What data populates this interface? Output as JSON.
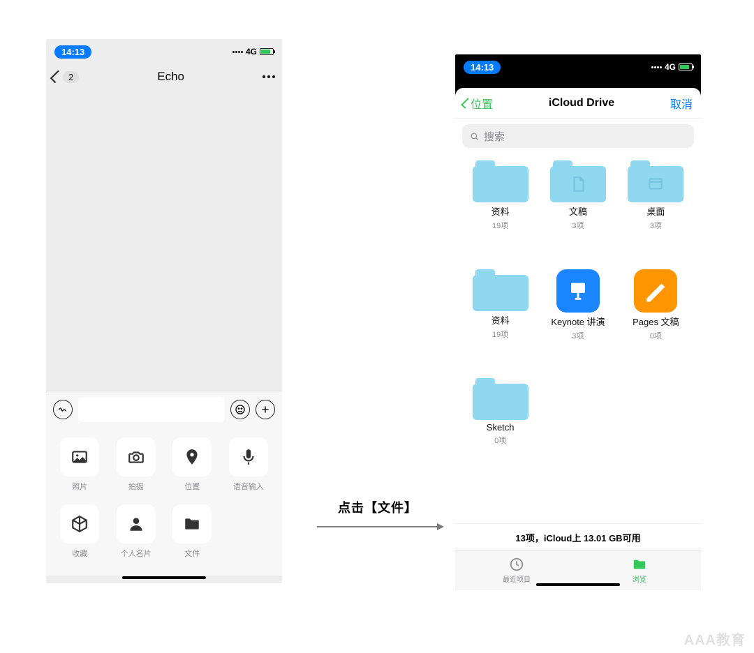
{
  "left": {
    "status": {
      "time": "14:13",
      "network": "4G"
    },
    "nav": {
      "unread": "2",
      "title": "Echo"
    },
    "attach": [
      {
        "id": "photo",
        "label": "照片"
      },
      {
        "id": "camera",
        "label": "拍摄"
      },
      {
        "id": "location",
        "label": "位置"
      },
      {
        "id": "voice",
        "label": "语音输入"
      },
      {
        "id": "fav",
        "label": "收藏"
      },
      {
        "id": "card",
        "label": "个人名片"
      },
      {
        "id": "file",
        "label": "文件"
      }
    ]
  },
  "caption": "点击【文件】",
  "right": {
    "status": {
      "time": "14:13",
      "network": "4G"
    },
    "nav": {
      "back": "位置",
      "title": "iCloud Drive",
      "cancel": "取消"
    },
    "search_placeholder": "搜索",
    "folders": [
      {
        "kind": "folder",
        "name": "资料",
        "meta": "19项",
        "inner": ""
      },
      {
        "kind": "folder",
        "name": "文稿",
        "meta": "3项",
        "inner": "doc"
      },
      {
        "kind": "folder",
        "name": "桌面",
        "meta": "3项",
        "inner": "window"
      },
      {
        "kind": "folder",
        "name": "资料",
        "meta": "19项",
        "inner": ""
      },
      {
        "kind": "app-keynote",
        "name": "Keynote 讲演",
        "meta": "3项"
      },
      {
        "kind": "app-pages",
        "name": "Pages 文稿",
        "meta": "0项"
      },
      {
        "kind": "folder",
        "name": "Sketch",
        "meta": "0项",
        "inner": ""
      }
    ],
    "storage": "13项，iCloud上 13.01 GB可用",
    "tabs": {
      "recent": "最近项目",
      "browse": "浏览"
    }
  },
  "watermark": "AAA教育"
}
